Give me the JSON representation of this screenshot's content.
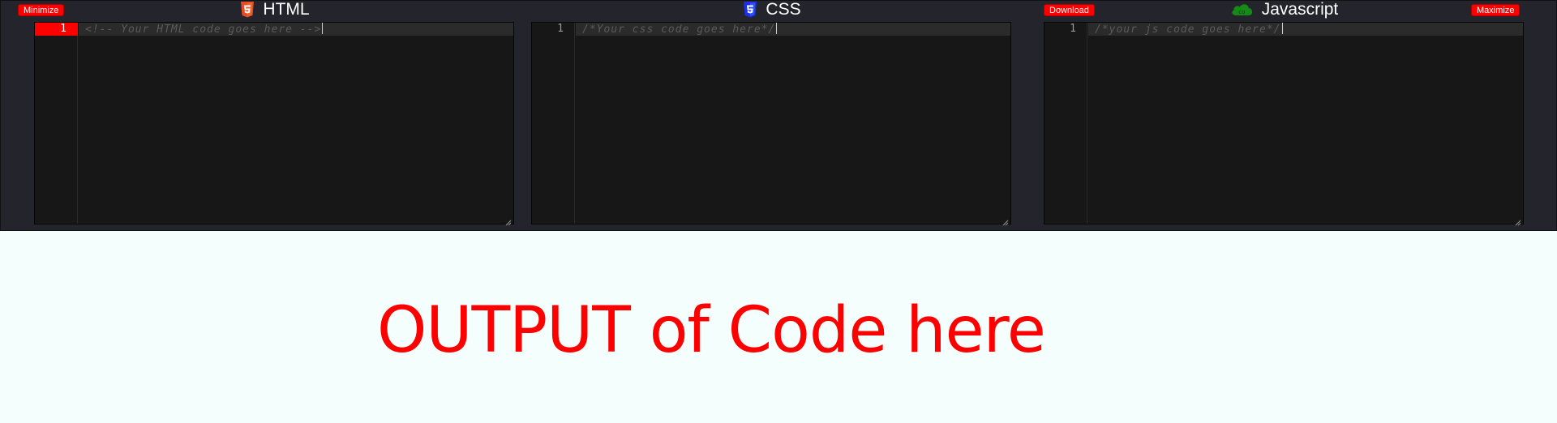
{
  "controls": {
    "minimize_label": "Minimize",
    "download_label": "Download",
    "maximize_label": "Maximize"
  },
  "panes": [
    {
      "title": "HTML",
      "icon": "html5-icon",
      "icon_color": "#e34c26",
      "line_number": "1",
      "placeholder": "<!-- Your HTML code goes here -->"
    },
    {
      "title": "CSS",
      "icon": "css3-icon",
      "icon_color": "#1e2ee8",
      "line_number": "1",
      "placeholder": "/*Your css code goes here*/"
    },
    {
      "title": "Javascript",
      "icon": "js-cloud-icon",
      "icon_color": "#168a16",
      "line_number": "1",
      "placeholder": "/*your js code goes here*/"
    }
  ],
  "output": {
    "text": "OUTPUT of Code here",
    "color": "#ff0000"
  },
  "colors": {
    "editor_bg": "#171717",
    "panel_bg": "#24242c",
    "accent": "#ff0000",
    "output_bg": "#f3fefd"
  }
}
